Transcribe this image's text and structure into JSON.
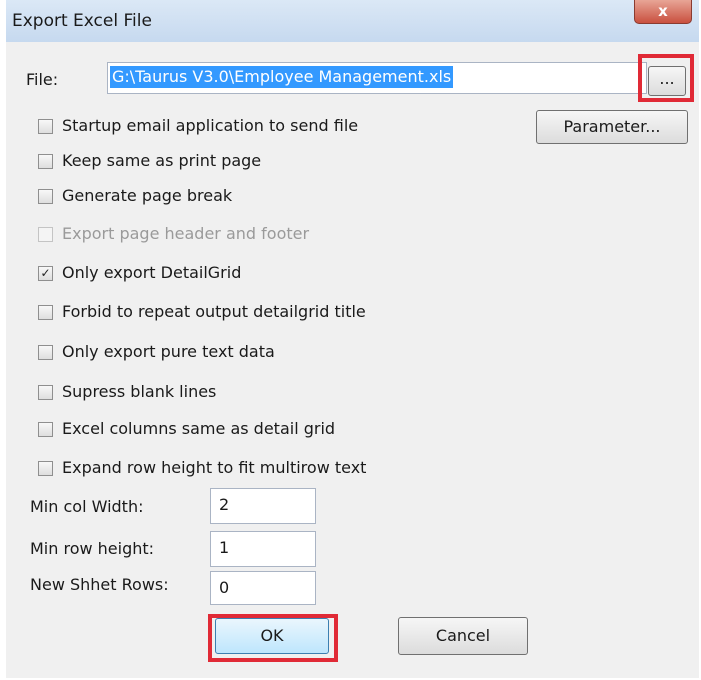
{
  "dialog": {
    "title": "Export Excel File",
    "close_label": "x"
  },
  "file": {
    "label": "File:",
    "value": "G:\\Taurus V3.0\\Employee Management.xls",
    "browse_label": "..."
  },
  "parameter_button": "Parameter...",
  "options": [
    {
      "label": "Startup email application to send file",
      "checked": false,
      "enabled": true
    },
    {
      "label": "Keep same as print page",
      "checked": false,
      "enabled": true
    },
    {
      "label": "Generate page break",
      "checked": false,
      "enabled": true
    },
    {
      "label": "Export page header and footer",
      "checked": false,
      "enabled": false
    },
    {
      "label": "Only export DetailGrid",
      "checked": true,
      "enabled": true
    },
    {
      "label": "Forbid to repeat output detailgrid title",
      "checked": false,
      "enabled": true
    },
    {
      "label": "Only export pure text data",
      "checked": false,
      "enabled": true
    },
    {
      "label": "Supress blank lines",
      "checked": false,
      "enabled": true
    },
    {
      "label": "Excel columns same as detail grid",
      "checked": false,
      "enabled": true
    },
    {
      "label": "Expand row height to fit multirow text",
      "checked": false,
      "enabled": true
    }
  ],
  "fields": {
    "min_col_width": {
      "label": "Min col Width:",
      "value": "2"
    },
    "min_row_height": {
      "label": "Min row height:",
      "value": "1"
    },
    "new_sheet_rows": {
      "label": "New Shhet Rows:",
      "value": "0"
    }
  },
  "buttons": {
    "ok": "OK",
    "cancel": "Cancel"
  },
  "colors": {
    "highlight": "#e02a36",
    "selection": "#3399ff"
  }
}
